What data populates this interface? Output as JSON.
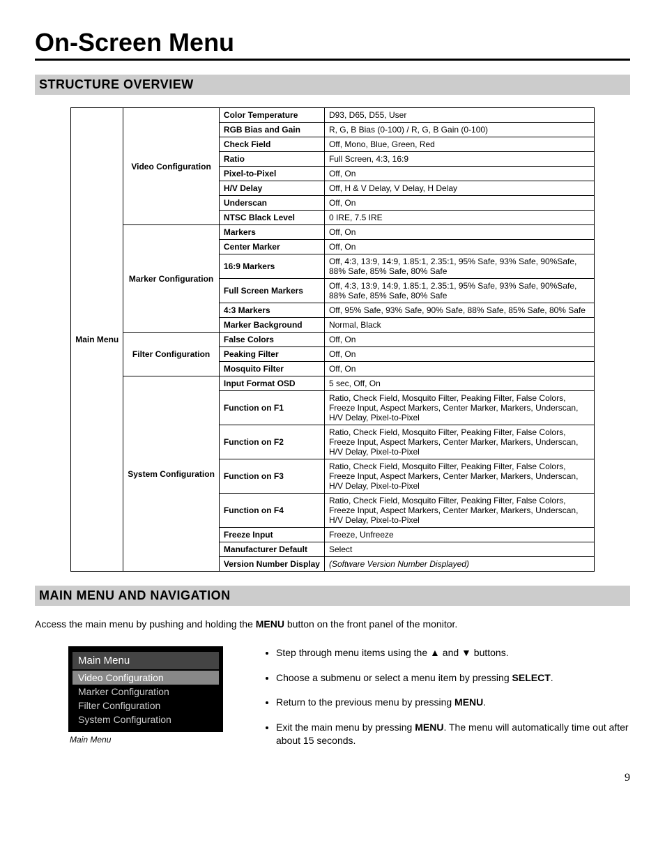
{
  "page_title": "On-Screen Menu",
  "section_structure": "STRUCTURE OVERVIEW",
  "main_label": "Main Menu",
  "groups": [
    {
      "name": "Video Configuration",
      "rows": [
        {
          "param": "Color Temperature",
          "values": "D93, D65, D55, User"
        },
        {
          "param": "RGB Bias and Gain",
          "values": "R, G, B Bias (0-100) / R, G, B Gain (0-100)"
        },
        {
          "param": "Check Field",
          "values": "Off, Mono, Blue, Green, Red"
        },
        {
          "param": "Ratio",
          "values": "Full Screen, 4:3, 16:9"
        },
        {
          "param": "Pixel-to-Pixel",
          "values": "Off, On"
        },
        {
          "param": "H/V Delay",
          "values": "Off, H & V Delay, V Delay, H Delay"
        },
        {
          "param": "Underscan",
          "values": "Off, On"
        },
        {
          "param": "NTSC Black Level",
          "values": "0 IRE, 7.5 IRE"
        }
      ]
    },
    {
      "name": "Marker Configuration",
      "rows": [
        {
          "param": "Markers",
          "values": "Off, On"
        },
        {
          "param": "Center Marker",
          "values": "Off, On"
        },
        {
          "param": "16:9 Markers",
          "values": "Off, 4:3, 13:9, 14:9, 1.85:1, 2.35:1, 95% Safe, 93% Safe, 90%Safe, 88% Safe, 85% Safe, 80% Safe"
        },
        {
          "param": "Full Screen Markers",
          "values": "Off, 4:3, 13:9, 14:9, 1.85:1, 2.35:1, 95% Safe, 93% Safe, 90%Safe, 88% Safe, 85% Safe, 80% Safe"
        },
        {
          "param": "4:3 Markers",
          "values": "Off, 95% Safe, 93% Safe, 90% Safe, 88% Safe, 85% Safe, 80% Safe"
        },
        {
          "param": "Marker Background",
          "values": "Normal, Black"
        }
      ]
    },
    {
      "name": "Filter Configuration",
      "rows": [
        {
          "param": "False Colors",
          "values": "Off, On"
        },
        {
          "param": "Peaking Filter",
          "values": "Off, On"
        },
        {
          "param": "Mosquito Filter",
          "values": "Off, On"
        }
      ]
    },
    {
      "name": "System Configuration",
      "rows": [
        {
          "param": "Input Format OSD",
          "values": "5 sec, Off, On"
        },
        {
          "param": "Function on F1",
          "values": "Ratio, Check Field, Mosquito Filter, Peaking Filter, False Colors, Freeze Input, Aspect Markers, Center Marker, Markers, Underscan, H/V Delay, Pixel-to-Pixel"
        },
        {
          "param": "Function on F2",
          "values": "Ratio, Check Field, Mosquito Filter, Peaking Filter, False Colors, Freeze Input, Aspect Markers, Center Marker, Markers, Underscan, H/V Delay, Pixel-to-Pixel"
        },
        {
          "param": "Function on F3",
          "values": "Ratio, Check Field, Mosquito Filter, Peaking Filter, False Colors, Freeze Input, Aspect Markers, Center Marker, Markers, Underscan, H/V Delay, Pixel-to-Pixel"
        },
        {
          "param": "Function on F4",
          "values": "Ratio, Check Field, Mosquito Filter, Peaking Filter, False Colors, Freeze Input, Aspect Markers, Center Marker, Markers, Underscan, H/V Delay, Pixel-to-Pixel"
        },
        {
          "param": "Freeze Input",
          "values": "Freeze, Unfreeze"
        },
        {
          "param": "Manufacturer Default",
          "values": "Select"
        },
        {
          "param": "Version Number Display",
          "values": "(Software Version Number Displayed)",
          "italic": true
        }
      ]
    }
  ],
  "section_nav": "MAIN MENU AND NAVIGATION",
  "intro_pre": "Access the main menu by pushing and holding the ",
  "intro_bold": "MENU",
  "intro_post": " button on the front panel of the monitor.",
  "menu_box": {
    "title": "Main Menu",
    "items": [
      "Video Configuration",
      "Marker Configuration",
      "Filter Configuration",
      "System Configuration"
    ],
    "caption": "Main Menu"
  },
  "steps": {
    "s1_a": "Step through menu items using the ",
    "s1_up": "▲",
    "s1_mid": " and ",
    "s1_down": "▼",
    "s1_b": " buttons.",
    "s2_a": "Choose a submenu or select a menu item by pressing ",
    "s2_bold": "SELECT",
    "s2_b": ".",
    "s3_a": "Return to the previous menu by pressing ",
    "s3_bold": "MENU",
    "s3_b": ".",
    "s4_a": "Exit the main menu by pressing ",
    "s4_bold": "MENU",
    "s4_b": ". The menu will automatically time out after about 15 seconds."
  },
  "page_number": "9"
}
